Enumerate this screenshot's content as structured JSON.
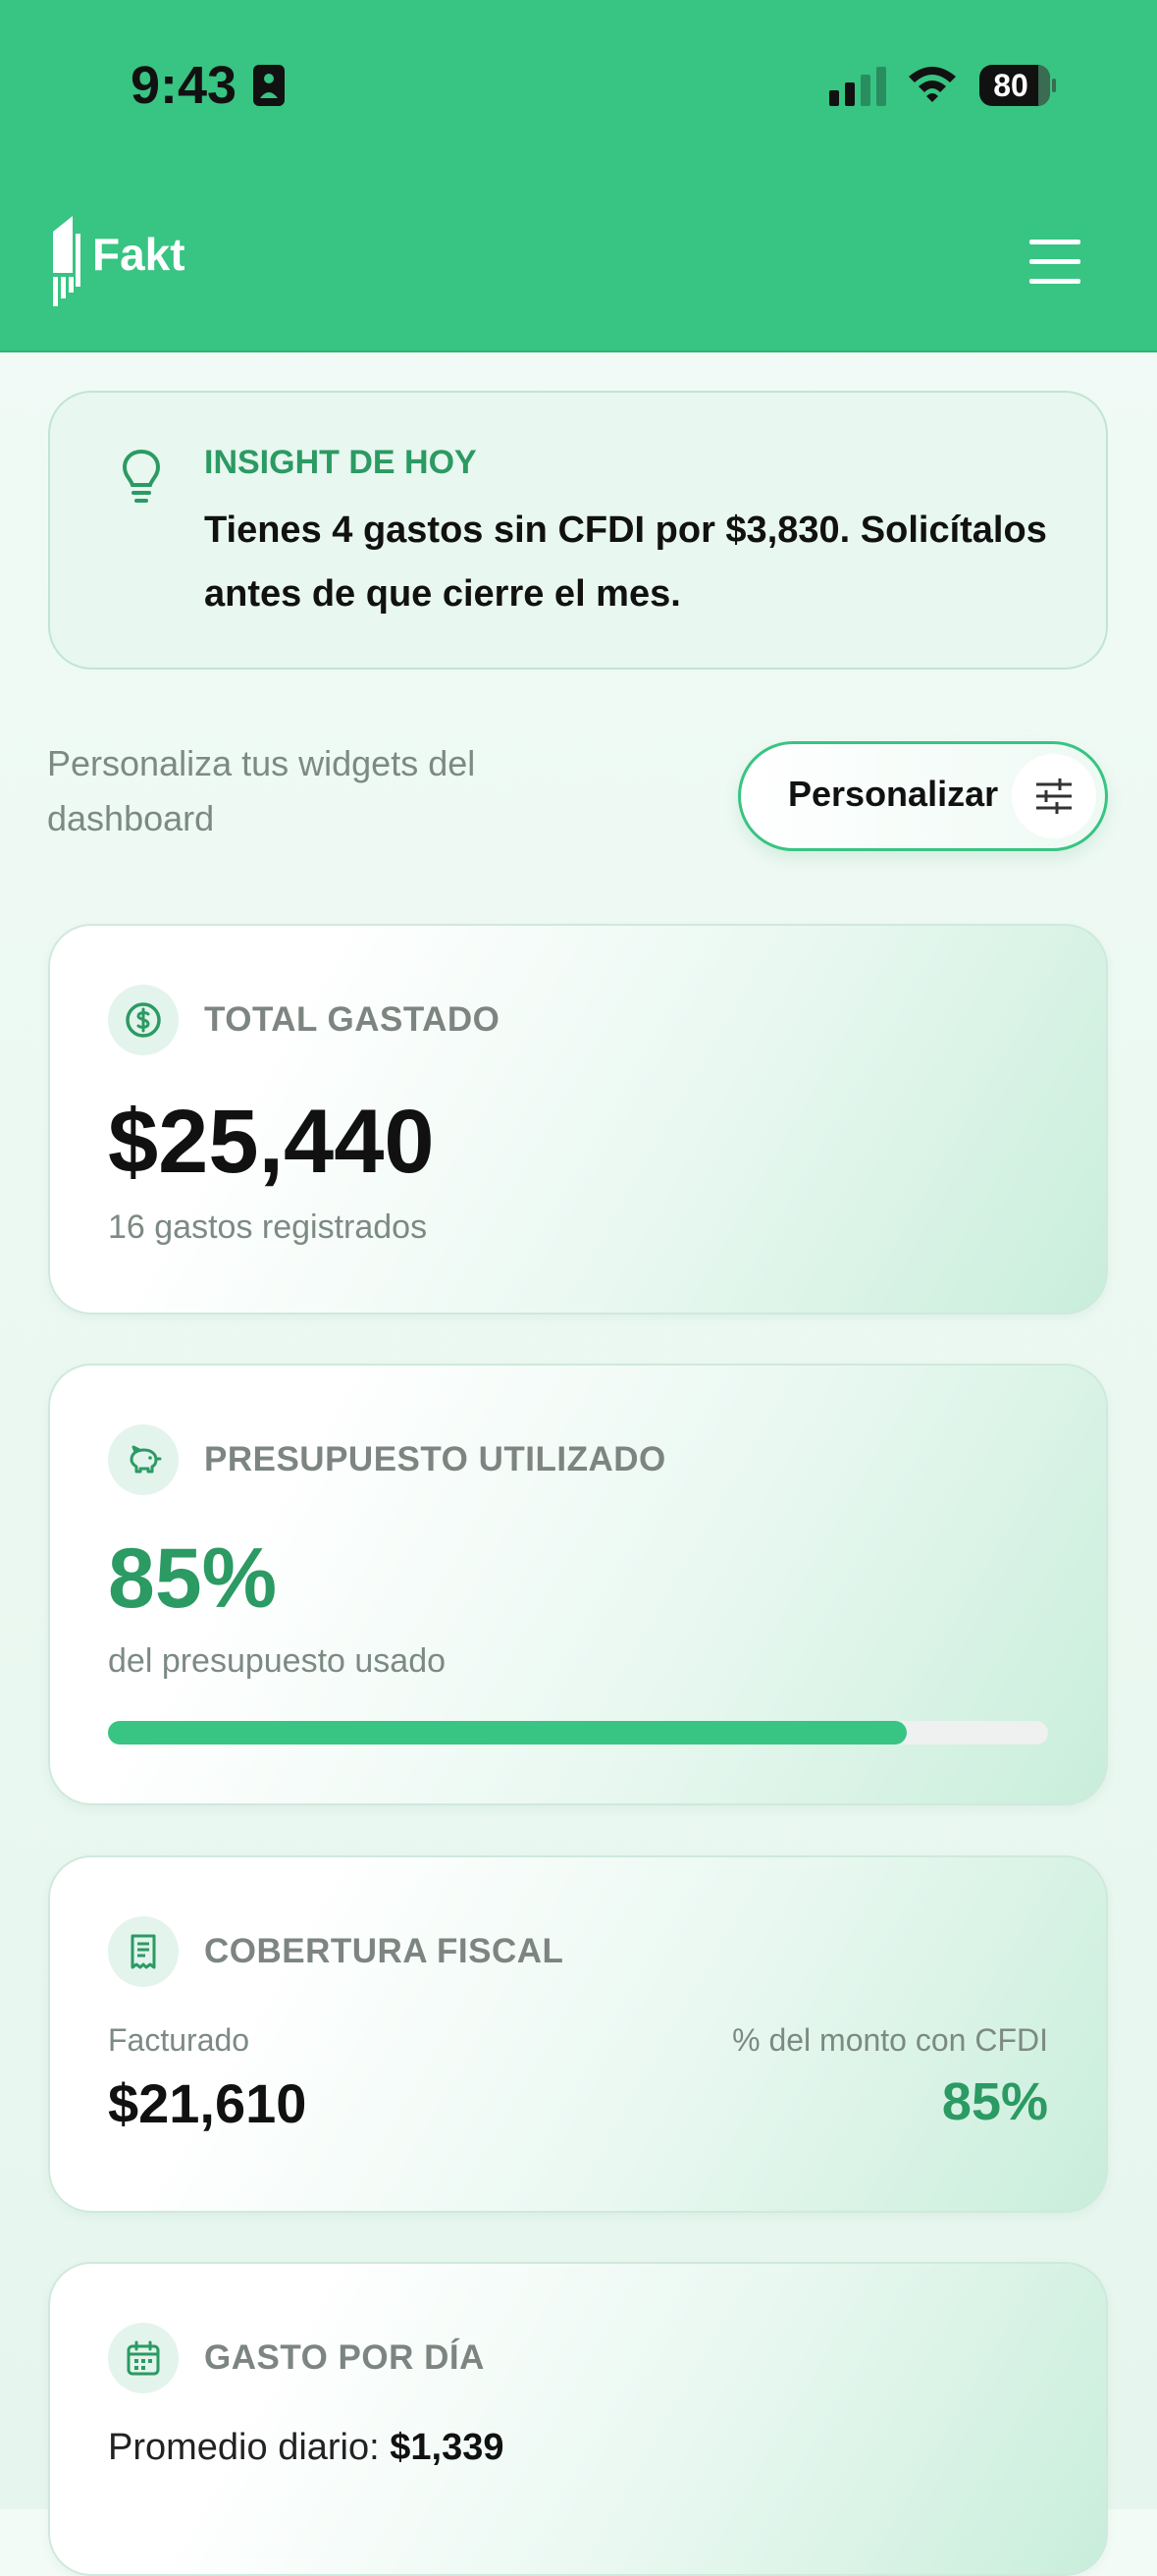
{
  "status_bar": {
    "time": "9:43",
    "battery": "80"
  },
  "header": {
    "app_name": "Fakt"
  },
  "insight": {
    "label": "INSIGHT DE HOY",
    "text": "Tienes 4 gastos sin CFDI por $3,830. Solicítalos antes de que cierre el mes."
  },
  "personalize": {
    "description": "Personaliza tus widgets del dashboard",
    "button_label": "Personalizar"
  },
  "widgets": {
    "total": {
      "title": "TOTAL GASTADO",
      "value": "$25,440",
      "subtitle": "16 gastos registrados"
    },
    "budget": {
      "title": "PRESUPUESTO UTILIZADO",
      "value": "85%",
      "subtitle": "del presupuesto usado",
      "progress_fraction": 0.85
    },
    "coverage": {
      "title": "COBERTURA FISCAL",
      "left_label": "Facturado",
      "left_value": "$21,610",
      "right_label": "% del monto con CFDI",
      "right_value": "85%"
    },
    "daily": {
      "title": "GASTO POR DÍA",
      "avg_label": "Promedio diario:",
      "avg_value": "$1,339"
    }
  },
  "colors": {
    "brand_green": "#38c482",
    "accent_text_green": "#2b9a63"
  }
}
